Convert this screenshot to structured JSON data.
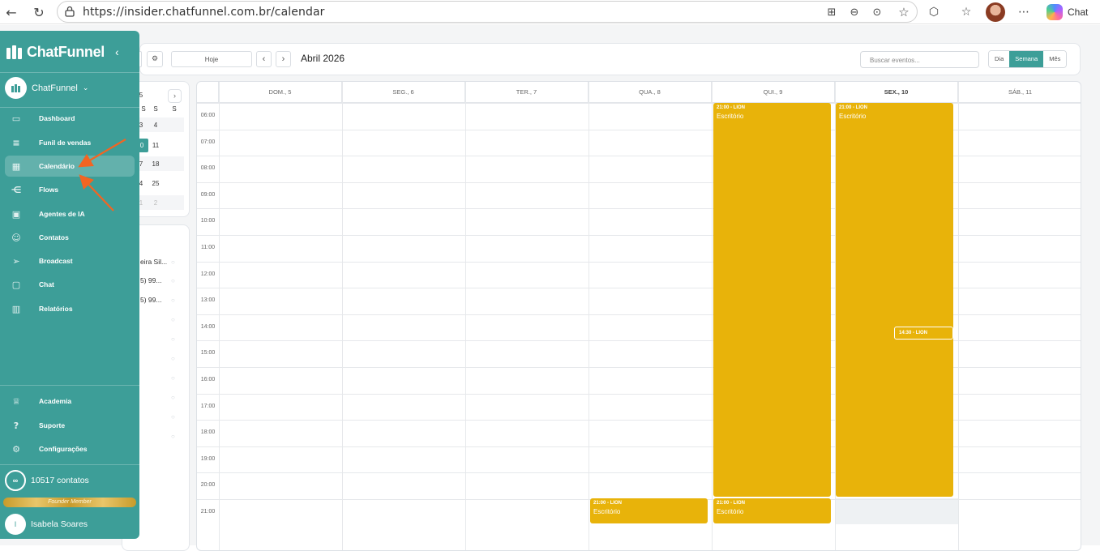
{
  "browser": {
    "url": "https://insider.chatfunnel.com.br/calendar",
    "chat_label": "Chat"
  },
  "sidebar": {
    "brand": "ChatFunnel",
    "workspace": "ChatFunnel",
    "items": [
      {
        "label": "Dashboard",
        "icon": "dashboard-icon"
      },
      {
        "label": "Funil de vendas",
        "icon": "funnel-icon"
      },
      {
        "label": "Calendário",
        "icon": "calendar-icon",
        "active": true
      },
      {
        "label": "Flows",
        "icon": "flows-icon"
      },
      {
        "label": "Agentes de IA",
        "icon": "bot-icon"
      },
      {
        "label": "Contatos",
        "icon": "contacts-icon"
      },
      {
        "label": "Broadcast",
        "icon": "send-icon"
      },
      {
        "label": "Chat",
        "icon": "chat-icon"
      },
      {
        "label": "Relatórios",
        "icon": "chart-icon"
      }
    ],
    "bottom_items": [
      {
        "label": "Academia",
        "icon": "graduation-icon"
      },
      {
        "label": "Suporte",
        "icon": "help-icon"
      },
      {
        "label": "Configurações",
        "icon": "gear-icon"
      }
    ],
    "contacts_count": "10517 contatos",
    "contacts_badge": "∞",
    "founder_label": "Founder Member",
    "user_initial": "I",
    "user_name": "Isabela Soares"
  },
  "toolbar": {
    "today_label": "Hoje",
    "month_label": "Abril 2026",
    "search_placeholder": "Buscar eventos...",
    "views": [
      "Dia",
      "Semana",
      "Mês"
    ],
    "active_view": "Semana"
  },
  "mini_calendar": {
    "header_visible": [
      "S",
      "S"
    ],
    "header_partial": "S",
    "partial_day": "5",
    "rows": [
      {
        "partial": "3",
        "a": "4"
      },
      {
        "partial": "0",
        "a": "11"
      },
      {
        "partial": "7",
        "a": "18"
      },
      {
        "partial": "4",
        "a": "25"
      },
      {
        "partial": "1",
        "a": "2"
      }
    ]
  },
  "contact_list": [
    "eira Sil...",
    "5) 99...",
    "5) 99..."
  ],
  "calendar": {
    "days": [
      "DOM., 5",
      "SEG., 6",
      "TER., 7",
      "QUA., 8",
      "QUI., 9",
      "SEX., 10",
      "SÁB., 11"
    ],
    "today_index": 5,
    "hours": [
      "06:00",
      "07:00",
      "08:00",
      "09:00",
      "10:00",
      "11:00",
      "12:00",
      "13:00",
      "14:00",
      "15:00",
      "16:00",
      "17:00",
      "18:00",
      "19:00",
      "20:00",
      "21:00"
    ],
    "events": [
      {
        "day": 4,
        "time": "21:00 - LION",
        "title": "Escritório",
        "span": "06:00-20:45"
      },
      {
        "day": 5,
        "time": "21:00 - LION",
        "title": "Escritório",
        "span": "06:00-20:45"
      },
      {
        "day": 5,
        "time": "14:30 - LION",
        "title": "",
        "span": "14:30"
      },
      {
        "day": 3,
        "time": "21:00 - LION",
        "title": "Escritório",
        "span": "21:00-22:00"
      },
      {
        "day": 4,
        "time": "21:00 - LION",
        "title": "Escritório",
        "span": "21:00-22:00"
      }
    ]
  }
}
